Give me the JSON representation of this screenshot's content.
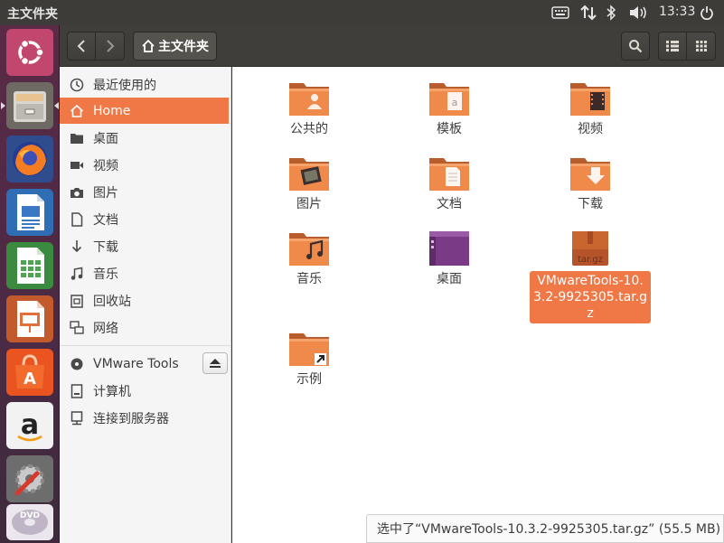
{
  "top_panel": {
    "app_title": "主文件夹",
    "clock": "13:33",
    "indicators": [
      "keyboard-icon",
      "network-icon",
      "bluetooth-icon",
      "volume-icon",
      "power-icon"
    ]
  },
  "launcher": {
    "items": [
      "ubuntu-dash",
      "files",
      "firefox",
      "libreoffice-writer",
      "libreoffice-calc",
      "libreoffice-impress",
      "ubuntu-software",
      "amazon",
      "system-settings",
      "dvd"
    ]
  },
  "header": {
    "path_label": "主文件夹",
    "back_icon": "chevron-left-icon",
    "forward_icon": "chevron-right-icon"
  },
  "sidebar": {
    "items": [
      {
        "label": "最近使用的",
        "icon": "clock-icon"
      },
      {
        "label": "Home",
        "icon": "home-icon"
      },
      {
        "label": "桌面",
        "icon": "folder-icon"
      },
      {
        "label": "视频",
        "icon": "video-icon"
      },
      {
        "label": "图片",
        "icon": "camera-icon"
      },
      {
        "label": "文档",
        "icon": "document-icon"
      },
      {
        "label": "下载",
        "icon": "download-icon"
      },
      {
        "label": "音乐",
        "icon": "music-icon"
      },
      {
        "label": "回收站",
        "icon": "trash-icon"
      },
      {
        "label": "网络",
        "icon": "network-icon"
      },
      {
        "label": "VMware Tools",
        "icon": "disc-icon"
      },
      {
        "label": "计算机",
        "icon": "drive-icon"
      },
      {
        "label": "连接到服务器",
        "icon": "server-icon"
      }
    ]
  },
  "files": [
    {
      "label": "公共的",
      "type": "public"
    },
    {
      "label": "模板",
      "type": "templates"
    },
    {
      "label": "视频",
      "type": "videos"
    },
    {
      "label": "图片",
      "type": "pictures"
    },
    {
      "label": "文档",
      "type": "documents"
    },
    {
      "label": "下载",
      "type": "downloads"
    },
    {
      "label": "音乐",
      "type": "music"
    },
    {
      "label": "桌面",
      "type": "desktop"
    },
    {
      "label": "VMwareTools-10.3.2-9925305.tar.gz",
      "type": "archive",
      "selected": true
    },
    {
      "label": "示例",
      "type": "examples"
    }
  ],
  "archive_icon_text": "tar.gz",
  "status": {
    "text": "选中了“VMwareTools-10.3.2-9925305.tar.gz” (55.5 MB)"
  },
  "colors": {
    "accent": "#f07746",
    "panel": "#3d3c38",
    "launcher": "#4b2a44"
  }
}
